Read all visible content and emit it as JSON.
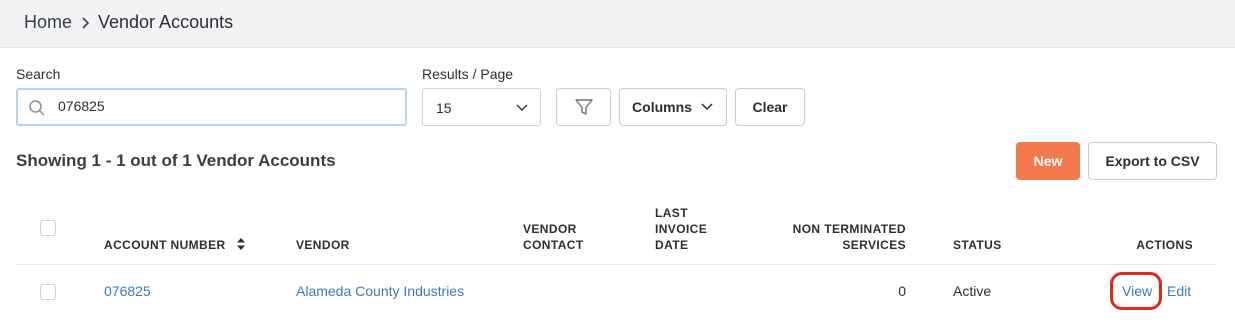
{
  "breadcrumb": {
    "home": "Home",
    "current": "Vendor Accounts"
  },
  "search": {
    "label": "Search",
    "value": "076825",
    "placeholder": ""
  },
  "results_per_page": {
    "label": "Results / Page",
    "selected": "15"
  },
  "toolbar": {
    "columns_label": "Columns",
    "clear_label": "Clear",
    "new_label": "New",
    "export_label": "Export to CSV"
  },
  "summary": "Showing 1 - 1 out of 1 Vendor Accounts",
  "table": {
    "headers": {
      "account_number": "ACCOUNT NUMBER",
      "vendor": "VENDOR",
      "vendor_contact": [
        "VENDOR",
        "CONTACT"
      ],
      "last_invoice_date": [
        "LAST",
        "INVOICE",
        "DATE"
      ],
      "non_terminated_services": [
        "NON TERMINATED",
        "SERVICES"
      ],
      "status": "STATUS",
      "actions": "ACTIONS"
    },
    "rows": [
      {
        "account_number": "076825",
        "vendor": "Alameda County Industries",
        "vendor_contact": "",
        "last_invoice_date": "",
        "non_terminated_services": "0",
        "status": "Active",
        "action_view": "View",
        "action_edit": "Edit"
      }
    ]
  },
  "colors": {
    "accent": "#f47a4d",
    "link": "#3d7ab8",
    "highlight": "#e0281b",
    "topbar": "#f2f3f5"
  }
}
